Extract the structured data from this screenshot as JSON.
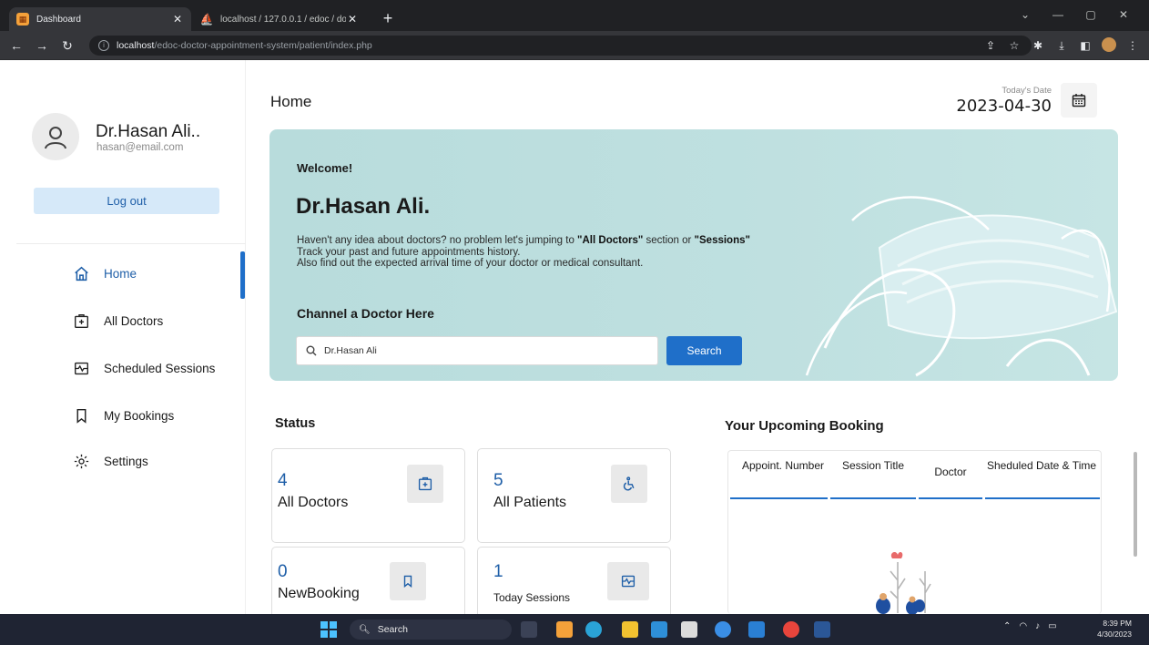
{
  "browser": {
    "tabs": [
      {
        "title": "Dashboard",
        "active": true
      },
      {
        "title": "localhost / 127.0.0.1 / edoc / doc",
        "active": false
      }
    ],
    "url_host": "localhost",
    "url_path": "/edoc-doctor-appointment-system/patient/index.php"
  },
  "sidebar": {
    "profile_name": "Dr.Hasan Ali..",
    "profile_email": "hasan@email.com",
    "logout_label": "Log out",
    "menu": [
      {
        "label": "Home",
        "icon": "home-icon",
        "active": true
      },
      {
        "label": "All Doctors",
        "icon": "doctor-icon",
        "active": false
      },
      {
        "label": "Scheduled Sessions",
        "icon": "sessions-icon",
        "active": false
      },
      {
        "label": "My Bookings",
        "icon": "bookmark-icon",
        "active": false
      },
      {
        "label": "Settings",
        "icon": "settings-icon",
        "active": false
      }
    ]
  },
  "header": {
    "title": "Home",
    "date_label": "Today's Date",
    "date_value": "2023-04-30"
  },
  "welcome": {
    "greeting": "Welcome!",
    "name": "Dr.Hasan Ali.",
    "line1_prefix": "Haven't any idea about doctors? no problem let's jumping to ",
    "line1_doctors": "\"All Doctors\"",
    "line1_mid": " section or ",
    "line1_sessions": "\"Sessions\"",
    "line2": "Track your past and future appointments history.",
    "line3": "Also find out the expected arrival time of your doctor or medical consultant.",
    "channel_title": "Channel a Doctor Here",
    "search_value": "Dr.Hasan Ali",
    "search_button": "Search"
  },
  "status": {
    "title": "Status",
    "cards": [
      {
        "number": "4",
        "label": "All Doctors",
        "icon": "doctor-icon"
      },
      {
        "number": "5",
        "label": "All Patients",
        "icon": "wheelchair-icon"
      },
      {
        "number": "0",
        "label": "NewBooking",
        "icon": "bookmark-icon"
      },
      {
        "number": "1",
        "label": "Today Sessions",
        "icon": "sessions-icon"
      }
    ]
  },
  "upcoming": {
    "title": "Your Upcoming Booking",
    "columns": [
      "Appoint. Number",
      "Session Title",
      "Doctor",
      "Sheduled Date & Time"
    ]
  },
  "taskbar": {
    "search_label": "Search",
    "time": "8:39 PM",
    "date": "4/30/2023"
  },
  "colors": {
    "accent": "#1f6fc9",
    "welcome_bg": "#bfe0e0",
    "taskbar": "#1f2433"
  }
}
